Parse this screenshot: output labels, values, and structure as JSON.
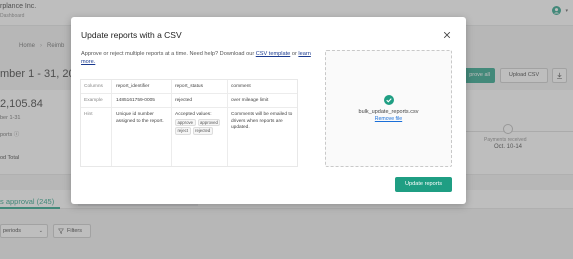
{
  "app": {
    "org_name": "rplance Inc.",
    "org_sub": "Dashboard"
  },
  "breadcrumb": {
    "home": "Home",
    "current": "Reimb"
  },
  "page": {
    "period_title": "mber 1 - 31, 20",
    "approve_all_label": "prove all",
    "upload_csv_label": "Upload CSV"
  },
  "summary": {
    "amount": "2,105.84",
    "date_range": "ber 1-31",
    "reports_label": "ports",
    "total_label": "od Total",
    "timeline_label": "Payments received",
    "timeline_date": "Oct. 10-14"
  },
  "tabs": {
    "active_label": "s approval (245)"
  },
  "filters": {
    "periods_label": "periods",
    "filters_label": "Filters"
  },
  "modal": {
    "title": "Update reports with a CSV",
    "intro_text": "Approve or reject multiple reports at a time. Need help? Download our",
    "csv_link": "CSV template",
    "or_text": "or",
    "learn_more": "learn more.",
    "table": {
      "row_labels": [
        "Columns",
        "Example",
        "Hint"
      ],
      "columns": [
        "report_identifier",
        "report_status",
        "comment"
      ],
      "example": [
        "1485161759-0005",
        "rejected",
        "over mileage limit"
      ],
      "hints": {
        "report_identifier": "Unique id number assigned to the report.",
        "report_status_text": "Accepted values:",
        "report_status_values": [
          "approve",
          "approved",
          "reject",
          "rejected"
        ],
        "comment": "Comments will be emailed to drivers when reports are updated."
      }
    },
    "upload": {
      "file_name": "bulk_update_reports.csv",
      "remove_label": "Remove file"
    },
    "update_button": "Update reports"
  },
  "colors": {
    "accent": "#1f9e83",
    "link": "#1a3a8f"
  }
}
